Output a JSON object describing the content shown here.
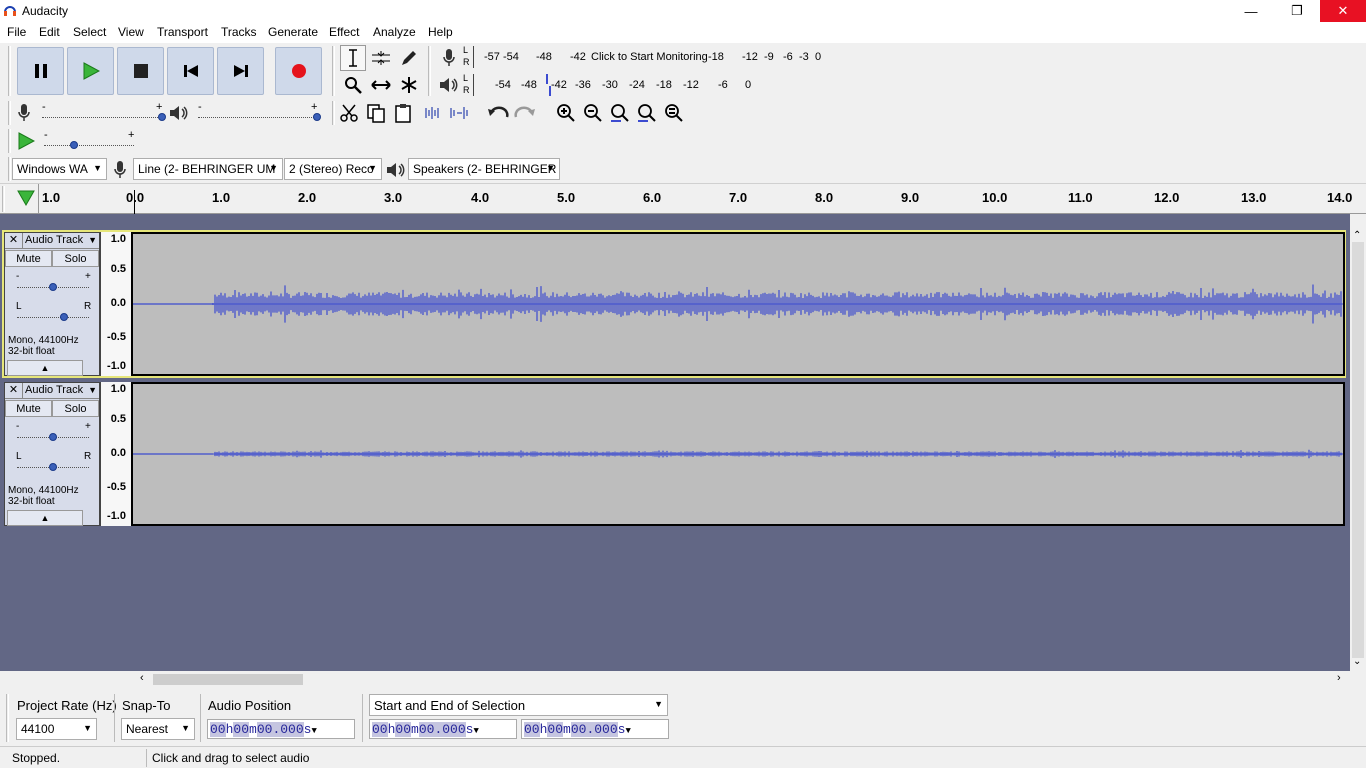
{
  "window": {
    "title": "Audacity",
    "min": "—",
    "restore": "❐",
    "close": "✕"
  },
  "menu": [
    "File",
    "Edit",
    "Select",
    "View",
    "Transport",
    "Tracks",
    "Generate",
    "Effect",
    "Analyze",
    "Help"
  ],
  "meters": {
    "record_ticks": [
      "-57",
      "-54",
      "-48",
      "-42",
      "-18",
      "-12",
      "-9",
      "-6",
      "-3",
      "0"
    ],
    "record_prompt": "Click to Start Monitoring",
    "play_ticks": [
      "-54",
      "-48",
      "-42",
      "-36",
      "-30",
      "-24",
      "-18",
      "-12",
      "-6",
      "0"
    ],
    "lr": [
      "L",
      "R"
    ]
  },
  "mixer": {
    "minus": "-",
    "plus": "+"
  },
  "devices": {
    "host": "Windows WA",
    "rec_device": "Line (2- BEHRINGER UM",
    "channels": "2 (Stereo) Reco",
    "play_device": "Speakers (2- BEHRINGER"
  },
  "ruler": {
    "labels": [
      "1.0",
      "0.0",
      "1.0",
      "2.0",
      "3.0",
      "4.0",
      "5.0",
      "6.0",
      "7.0",
      "8.0",
      "9.0",
      "10.0",
      "11.0",
      "12.0",
      "13.0",
      "14.0"
    ]
  },
  "tracks": [
    {
      "name": "Audio Track",
      "close": "✕",
      "mute": "Mute",
      "solo": "Solo",
      "gain_minus": "-",
      "gain_plus": "+",
      "pan_l": "L",
      "pan_r": "R",
      "info1": "Mono, 44100Hz",
      "info2": "32-bit float",
      "scale": [
        "1.0",
        "0.5",
        "0.0",
        "-0.5",
        "-1.0"
      ],
      "selected": true
    },
    {
      "name": "Audio Track",
      "close": "✕",
      "mute": "Mute",
      "solo": "Solo",
      "gain_minus": "-",
      "gain_plus": "+",
      "pan_l": "L",
      "pan_r": "R",
      "info1": "Mono, 44100Hz",
      "info2": "32-bit float",
      "scale": [
        "1.0",
        "0.5",
        "0.0",
        "-0.5",
        "-1.0"
      ],
      "selected": false
    }
  ],
  "selection_bar": {
    "rate_label": "Project Rate (Hz)",
    "rate_value": "44100",
    "snap_label": "Snap-To",
    "snap_value": "Nearest",
    "pos_label": "Audio Position",
    "sel_mode": "Start and End of Selection",
    "audio_position": [
      "00",
      "h",
      "00",
      "m",
      "00.000",
      "s"
    ],
    "sel_start": [
      "00",
      "h",
      "00",
      "m",
      "00.000",
      "s"
    ],
    "sel_end": [
      "00",
      "h",
      "00",
      "m",
      "00.000",
      "s"
    ]
  },
  "status": {
    "state": "Stopped.",
    "hint": "Click and drag to select audio"
  },
  "colors": {
    "record": "#e5131c",
    "play": "#3ab53a",
    "wave": "#3c4bd0",
    "track_bg": "#bdbdbd",
    "canvas": "#626785"
  }
}
